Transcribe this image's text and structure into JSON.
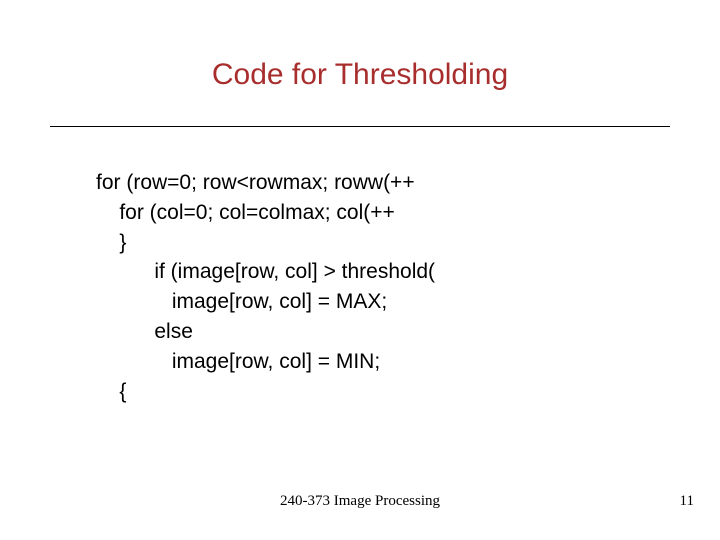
{
  "title": "Code for Thresholding",
  "code_lines": [
    "for (row=0; row<rowmax; roww(++",
    "    for (col=0; col=colmax; col(++",
    "    }",
    "          if (image[row, col] > threshold(",
    "             image[row, col] = MAX;",
    "          else",
    "             image[row, col] = MIN;",
    "    {"
  ],
  "footer": "240-373 Image Processing",
  "page_number": "11"
}
